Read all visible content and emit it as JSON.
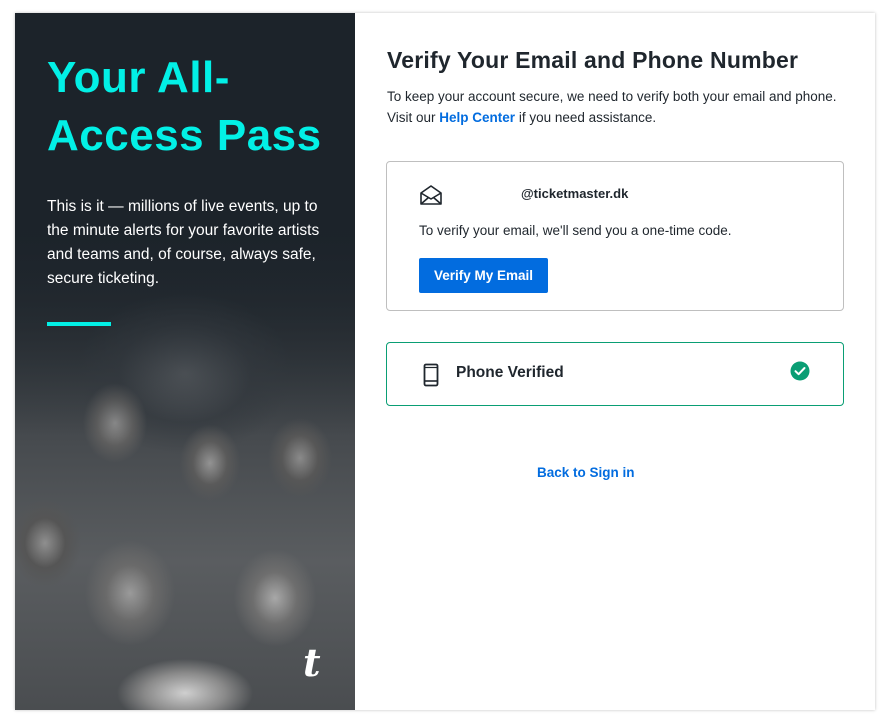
{
  "hero": {
    "title": "Your All-Access Pass",
    "description": "This is it — millions of live events, up to the minute alerts for your favorite artists and teams and, of course, always safe, secure ticketing.",
    "logo": "t",
    "accent_color": "#02f0e6",
    "background_color": "#1c232a"
  },
  "main": {
    "title": "Verify Your Email and Phone Number",
    "intro_prefix": "To keep your account secure, we need to verify both your email and phone. Visit our ",
    "help_link": "Help Center",
    "intro_suffix": " if you need assistance.",
    "email_card": {
      "icon": "envelope-icon",
      "email": "@ticketmaster.dk",
      "description": "To verify your email, we'll send you a one-time code.",
      "button_label": "Verify My Email"
    },
    "phone_card": {
      "icon": "mobile-phone-icon",
      "label": "Phone Verified",
      "status_icon": "check-circle-icon",
      "status_color": "#0a9e74"
    },
    "back_link": "Back to Sign in",
    "link_color": "#026cdf"
  }
}
